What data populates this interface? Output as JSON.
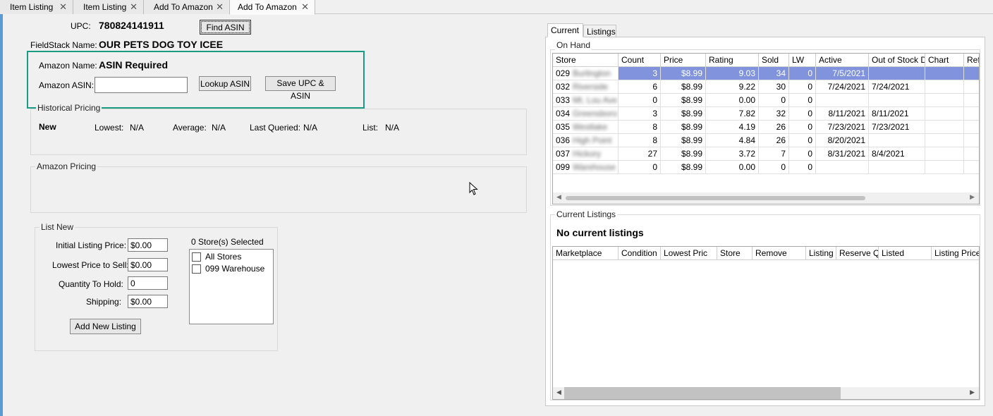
{
  "tabs": [
    {
      "label": "Item Listing"
    },
    {
      "label": "Item Listing"
    },
    {
      "label": "Add To Amazon"
    },
    {
      "label": "Add To Amazon"
    }
  ],
  "form": {
    "upc_label": "UPC:",
    "upc_value": "780824141911",
    "find_asin": "Find ASIN",
    "fieldstack_label": "FieldStack Name:",
    "fieldstack_value": "OUR PETS DOG TOY ICEE",
    "amazon_name_label": "Amazon Name:",
    "amazon_name_value": "ASIN Required",
    "amazon_asin_label": "Amazon ASIN:",
    "amazon_asin_value": "",
    "lookup_asin": "Lookup ASIN",
    "save_upc_asin": "Save UPC & ASIN"
  },
  "historical": {
    "title": "Historical Pricing",
    "condition": "New",
    "lowest_label": "Lowest:",
    "lowest": "N/A",
    "average_label": "Average:",
    "average": "N/A",
    "last_label": "Last Queried:",
    "last": "N/A",
    "list_label": "List:",
    "list": "N/A"
  },
  "amazon_pricing": {
    "title": "Amazon Pricing"
  },
  "list_new": {
    "title": "List New",
    "initial_label": "Initial Listing Price:",
    "initial": "$0.00",
    "lowest_label": "Lowest Price to Sell:",
    "lowest": "$0.00",
    "qty_label": "Quantity To Hold:",
    "qty": "0",
    "shipping_label": "Shipping:",
    "shipping": "$0.00",
    "stores_selected": "0 Store(s) Selected",
    "stores": [
      {
        "label": "All Stores",
        "checked": false
      },
      {
        "label": "099 Warehouse",
        "checked": false
      }
    ],
    "add_button": "Add New Listing"
  },
  "right": {
    "tabs": [
      {
        "label": "Current"
      },
      {
        "label": "Listings"
      }
    ],
    "on_hand_title": "On Hand",
    "on_hand_columns": [
      "Store",
      "Count",
      "Price",
      "Rating",
      "Sold",
      "LW",
      "Active",
      "Out of Stock D",
      "Chart",
      "Ref"
    ],
    "on_hand_rows": [
      {
        "store": "029",
        "store_name": "Burlington",
        "count": "3",
        "price": "$8.99",
        "rating": "9.03",
        "sold": "34",
        "lw": "0",
        "active": "7/5/2021",
        "oos": ""
      },
      {
        "store": "032",
        "store_name": "Riverside",
        "count": "6",
        "price": "$8.99",
        "rating": "9.22",
        "sold": "30",
        "lw": "0",
        "active": "7/24/2021",
        "oos": "7/24/2021"
      },
      {
        "store": "033",
        "store_name": "Mt. Lou Ave",
        "count": "0",
        "price": "$8.99",
        "rating": "0.00",
        "sold": "0",
        "lw": "0",
        "active": "",
        "oos": ""
      },
      {
        "store": "034",
        "store_name": "Greensboro",
        "count": "3",
        "price": "$8.99",
        "rating": "7.82",
        "sold": "32",
        "lw": "0",
        "active": "8/11/2021",
        "oos": "8/11/2021"
      },
      {
        "store": "035",
        "store_name": "Westlake",
        "count": "8",
        "price": "$8.99",
        "rating": "4.19",
        "sold": "26",
        "lw": "0",
        "active": "7/23/2021",
        "oos": "7/23/2021"
      },
      {
        "store": "036",
        "store_name": "High Point",
        "count": "8",
        "price": "$8.99",
        "rating": "4.84",
        "sold": "26",
        "lw": "0",
        "active": "8/20/2021",
        "oos": ""
      },
      {
        "store": "037",
        "store_name": "Hickory",
        "count": "27",
        "price": "$8.99",
        "rating": "3.72",
        "sold": "7",
        "lw": "0",
        "active": "8/31/2021",
        "oos": "8/4/2021"
      },
      {
        "store": "099",
        "store_name": "Warehouse",
        "count": "0",
        "price": "$8.99",
        "rating": "0.00",
        "sold": "0",
        "lw": "0",
        "active": "",
        "oos": ""
      }
    ],
    "current_listings_title": "Current Listings",
    "no_listings": "No current listings",
    "listing_columns": [
      "Marketplace",
      "Condition",
      "Lowest Pric",
      "Store",
      "Remove",
      "Listing",
      "Reserve Q",
      "Listed",
      "Listing Price"
    ]
  },
  "colors": {
    "highlight": "#1a9b84",
    "selected_row": "#8093dc"
  }
}
